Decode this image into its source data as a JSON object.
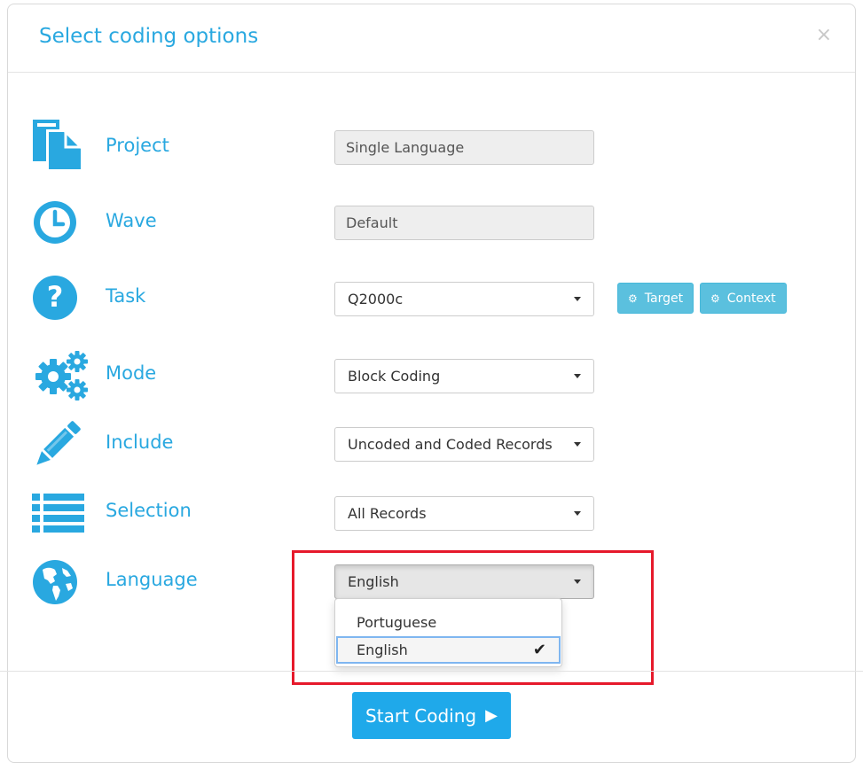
{
  "modal": {
    "title": "Select coding options",
    "close_glyph": "×"
  },
  "rows": {
    "project": {
      "label": "Project",
      "icon": "document-icon",
      "value": "Single Language"
    },
    "wave": {
      "label": "Wave",
      "icon": "clock-icon",
      "value": "Default"
    },
    "task": {
      "label": "Task",
      "icon": "question-icon",
      "value": "Q2000c"
    },
    "mode": {
      "label": "Mode",
      "icon": "gears-icon",
      "value": "Block Coding"
    },
    "include": {
      "label": "Include",
      "icon": "pencil-icon",
      "value": "Uncoded and Coded Records"
    },
    "selection": {
      "label": "Selection",
      "icon": "list-icon",
      "value": "All Records"
    },
    "language": {
      "label": "Language",
      "icon": "globe-icon",
      "value": "English"
    }
  },
  "task_buttons": {
    "target_label": "Target",
    "context_label": "Context",
    "gear_glyph": "⚙"
  },
  "language_dropdown": {
    "options": [
      "Portuguese",
      "English"
    ],
    "selected": "English",
    "check_glyph": "✔"
  },
  "footer": {
    "start_label": "Start Coding",
    "start_arrow": "▶"
  },
  "colors": {
    "accent": "#29a8e0",
    "primary_button": "#1fa9ea",
    "info_button": "#5bc0de",
    "highlight": "#e6192b"
  }
}
